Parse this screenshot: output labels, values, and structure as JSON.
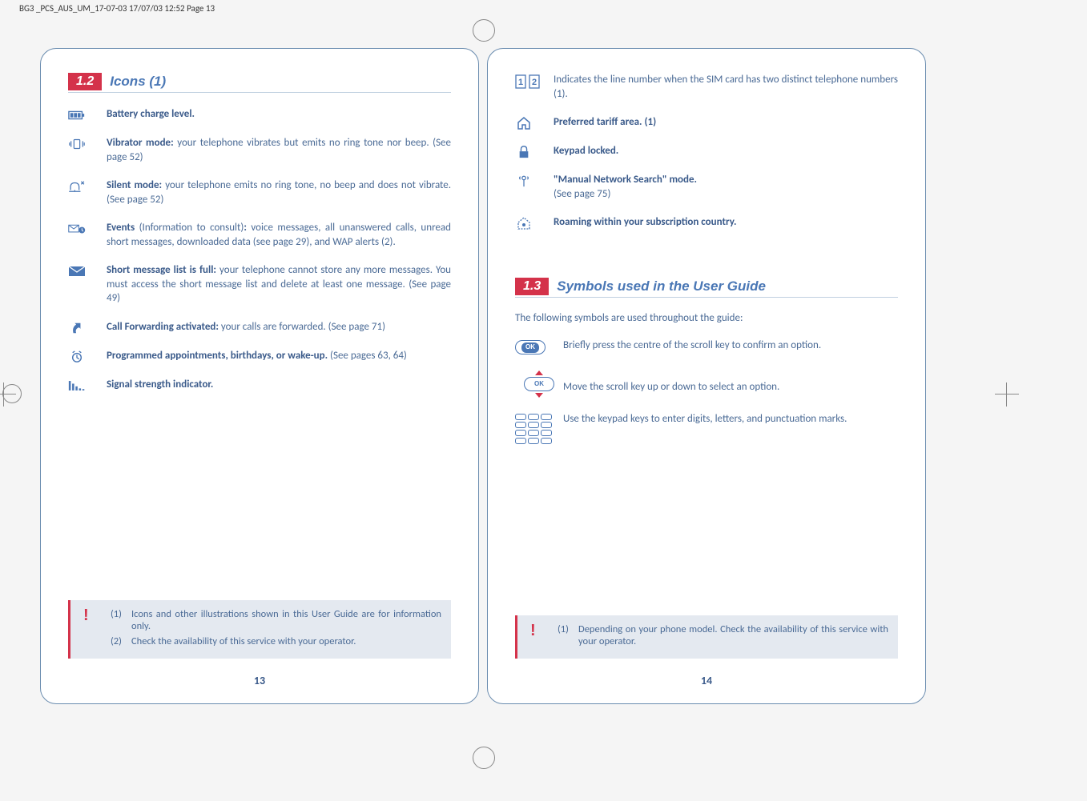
{
  "header": "BG3 _PCS_AUS_UM_17-07-03  17/07/03  12:52  Page 13",
  "left_page": {
    "section_num": "1.2",
    "section_title": "Icons (1)",
    "items": [
      {
        "icon": "battery",
        "bold": "Battery charge level.",
        "text": ""
      },
      {
        "icon": "vibrate",
        "bold": "Vibrator mode:",
        "text": " your telephone vibrates but emits no ring tone nor beep. (See page 52)"
      },
      {
        "icon": "silent",
        "bold": "Silent mode:",
        "text": " your telephone emits no ring tone, no beep and does not vibrate. (See page 52)"
      },
      {
        "icon": "events",
        "bold": "Events",
        "text2": " (Information to consult)",
        "bold2": ":",
        "text": " voice messages, all unanswered calls, unread short messages, downloaded data (see page 29), and WAP alerts (2)."
      },
      {
        "icon": "smsfull",
        "bold": "Short message list is full:",
        "text": " your telephone cannot store any more messages. You must access the short message list and delete at least one message. (See page 49)"
      },
      {
        "icon": "forward",
        "bold": "Call Forwarding activated:",
        "text": " your calls are forwarded. (See page 71)"
      },
      {
        "icon": "clock",
        "bold": "Programmed appointments, birthdays, or wake-up.",
        "text": " (See pages 63, 64)"
      },
      {
        "icon": "signal",
        "bold": "Signal strength indicator.",
        "text": ""
      }
    ],
    "footnotes": [
      {
        "num": "(1)",
        "text": "Icons and other illustrations shown in this User Guide are for information only."
      },
      {
        "num": "(2)",
        "text": "Check the availability of this service with your operator."
      }
    ],
    "page_num": "13"
  },
  "right_page": {
    "top_items": [
      {
        "icon": "line12",
        "text_pre": "Indicates the line number when the SIM card has two distinct telephone numbers (1)."
      },
      {
        "icon": "home",
        "bold": "Preferred tariff area. (1)"
      },
      {
        "icon": "lock",
        "bold": "Keypad locked."
      },
      {
        "icon": "antenna",
        "bold": "\"Manual Network Search\" mode.",
        "text": " (See page 75)"
      },
      {
        "icon": "roaming",
        "bold": "Roaming within your subscription country."
      }
    ],
    "section_num": "1.3",
    "section_title": "Symbols used in the User Guide",
    "intro": "The following symbols are used throughout the guide:",
    "symbols": [
      {
        "icon": "ok-press",
        "text": "Briefly press the centre of the scroll key to confirm an option."
      },
      {
        "icon": "ok-scroll",
        "text": "Move the scroll key up or down to select an option."
      },
      {
        "icon": "keypad",
        "text": "Use the keypad keys to enter digits, letters, and punctuation marks."
      }
    ],
    "footnotes": [
      {
        "num": "(1)",
        "text": "Depending on your phone model. Check the availability of this service with your operator."
      }
    ],
    "page_num": "14"
  }
}
